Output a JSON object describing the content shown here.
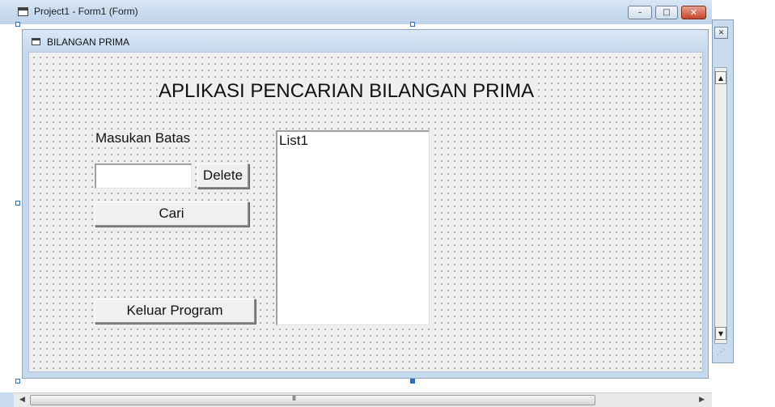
{
  "outer_window": {
    "title": "Project1 - Form1 (Form)",
    "controls": {
      "minimize": "–",
      "maximize": "□",
      "close": "✕"
    }
  },
  "form": {
    "caption": "BILANGAN PRIMA",
    "title_label": "APLIKASI PENCARIAN BILANGAN PRIMA",
    "batas_label": "Masukan Batas",
    "batas_input_value": "",
    "delete_button": "Delete",
    "cari_button": "Cari",
    "keluar_button": "Keluar Program",
    "list": {
      "items": [
        "List1"
      ]
    }
  },
  "scrollbar": {
    "left_arrow": "◀",
    "right_arrow": "▶",
    "grip": "III"
  },
  "side_window": {
    "close": "✕",
    "scroll_up": "▲",
    "scroll_down": "▼",
    "grip": "⋰"
  },
  "icons": {
    "window_icon": "form-window-icon",
    "form_icon": "form-window-icon"
  },
  "colors": {
    "title_bar": "#c9dcef",
    "form_background": "#efefef",
    "close_button": "#c6462a"
  }
}
